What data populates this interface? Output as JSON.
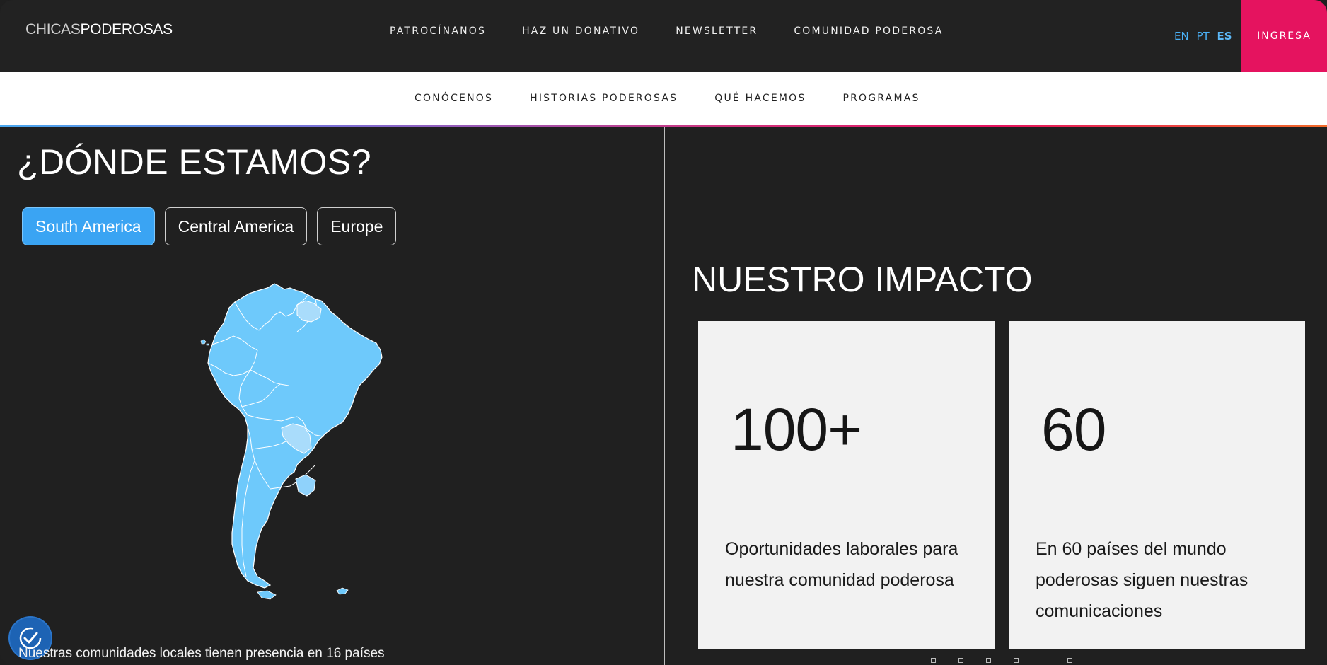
{
  "header": {
    "logo_light": "CHICAS",
    "logo_bold": "PODEROSAS",
    "nav": [
      "PATROCÍNANOS",
      "HAZ UN DONATIVO",
      "NEWSLETTER",
      "COMUNIDAD PODEROSA"
    ],
    "languages": [
      "EN",
      "PT",
      "ES"
    ],
    "active_language": "ES",
    "login_label": "INGRESA"
  },
  "subnav": [
    "CONÓCENOS",
    "HISTORIAS PODEROSAS",
    "QUÉ HACEMOS",
    "PROGRAMAS"
  ],
  "where": {
    "title": "¿DÓNDE ESTAMOS?",
    "regions": [
      "South America",
      "Central America",
      "Europe"
    ],
    "active_region": "South America",
    "presence_text": "Nuestras comunidades locales tienen presencia en 16 países"
  },
  "impact": {
    "title": "NUESTRO IMPACTO",
    "cards": [
      {
        "value": "100+",
        "description": "Oportunidades laborales para nuestra comunidad poderosa"
      },
      {
        "value": "60",
        "description": "En 60 países del mundo poderosas siguen nuestras comunicaciones"
      }
    ]
  },
  "colors": {
    "accent_pink": "#e5135f",
    "accent_blue": "#3aa4f3",
    "map_fill": "#6ec9fb",
    "map_highlight": "#a9dcfb",
    "background": "#202020"
  },
  "icons": {
    "accessibility": "accessibility-check-icon"
  }
}
